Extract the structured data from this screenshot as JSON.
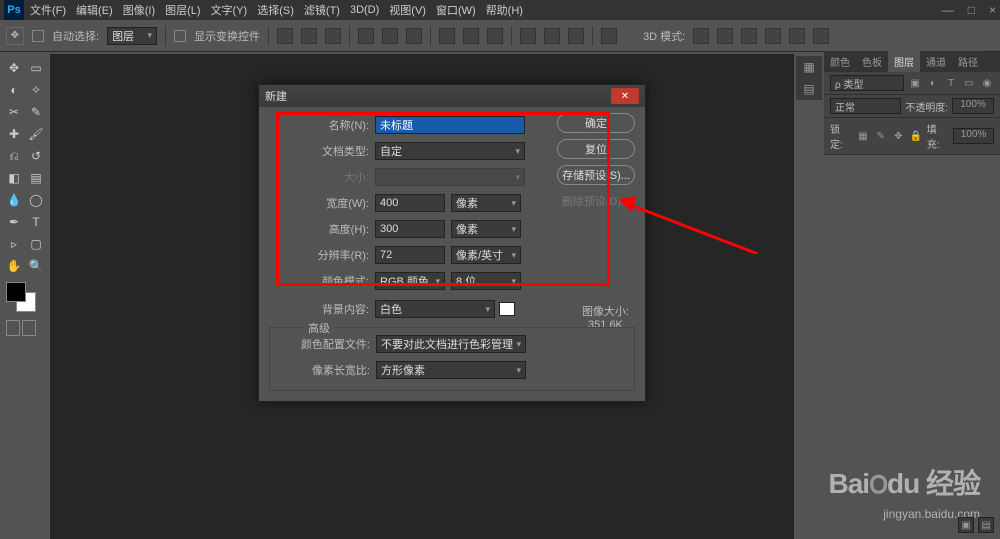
{
  "menu": {
    "items": [
      "文件(F)",
      "编辑(E)",
      "图像(I)",
      "图层(L)",
      "文字(Y)",
      "选择(S)",
      "滤镜(T)",
      "3D(D)",
      "视图(V)",
      "窗口(W)",
      "帮助(H)"
    ]
  },
  "opt": {
    "auto": "自动选择:",
    "layer": "图层",
    "show": "显示变换控件",
    "mode": "3D 模式:"
  },
  "panels": {
    "tabs": [
      "颜色",
      "色板",
      "图层",
      "通道",
      "路径"
    ],
    "kind": "ρ 类型",
    "blend": "正常",
    "opacity_lab": "不透明度:",
    "opacity": "100%",
    "lock": "锁定:",
    "fill_lab": "填充:",
    "fill": "100%"
  },
  "dialog": {
    "title": "新建",
    "name_lab": "名称(N):",
    "name_val": "未标题",
    "preset_lab": "文档类型:",
    "preset": "自定",
    "size_lab": "大小:",
    "width_lab": "宽度(W):",
    "width": "400",
    "width_u": "像素",
    "height_lab": "高度(H):",
    "height": "300",
    "height_u": "像素",
    "res_lab": "分辨率(R):",
    "res": "72",
    "res_u": "像素/英寸",
    "mode_lab": "颜色模式:",
    "mode": "RGB 颜色",
    "depth": "8 位",
    "bg_lab": "背景内容:",
    "bg": "白色",
    "adv": "高级",
    "profile_lab": "颜色配置文件:",
    "profile": "不要对此文档进行色彩管理",
    "aspect_lab": "像素长宽比:",
    "aspect": "方形像素",
    "imgsz_lab": "图像大小:",
    "imgsz": "351.6K",
    "btn_ok": "确定",
    "btn_reset": "复位",
    "btn_save": "存储预设(S)...",
    "btn_del": "删除预设(D)..."
  },
  "wm": {
    "brand": "Bai",
    "du": "du",
    "jing": "经验",
    "url": "jingyan.baidu.com"
  }
}
